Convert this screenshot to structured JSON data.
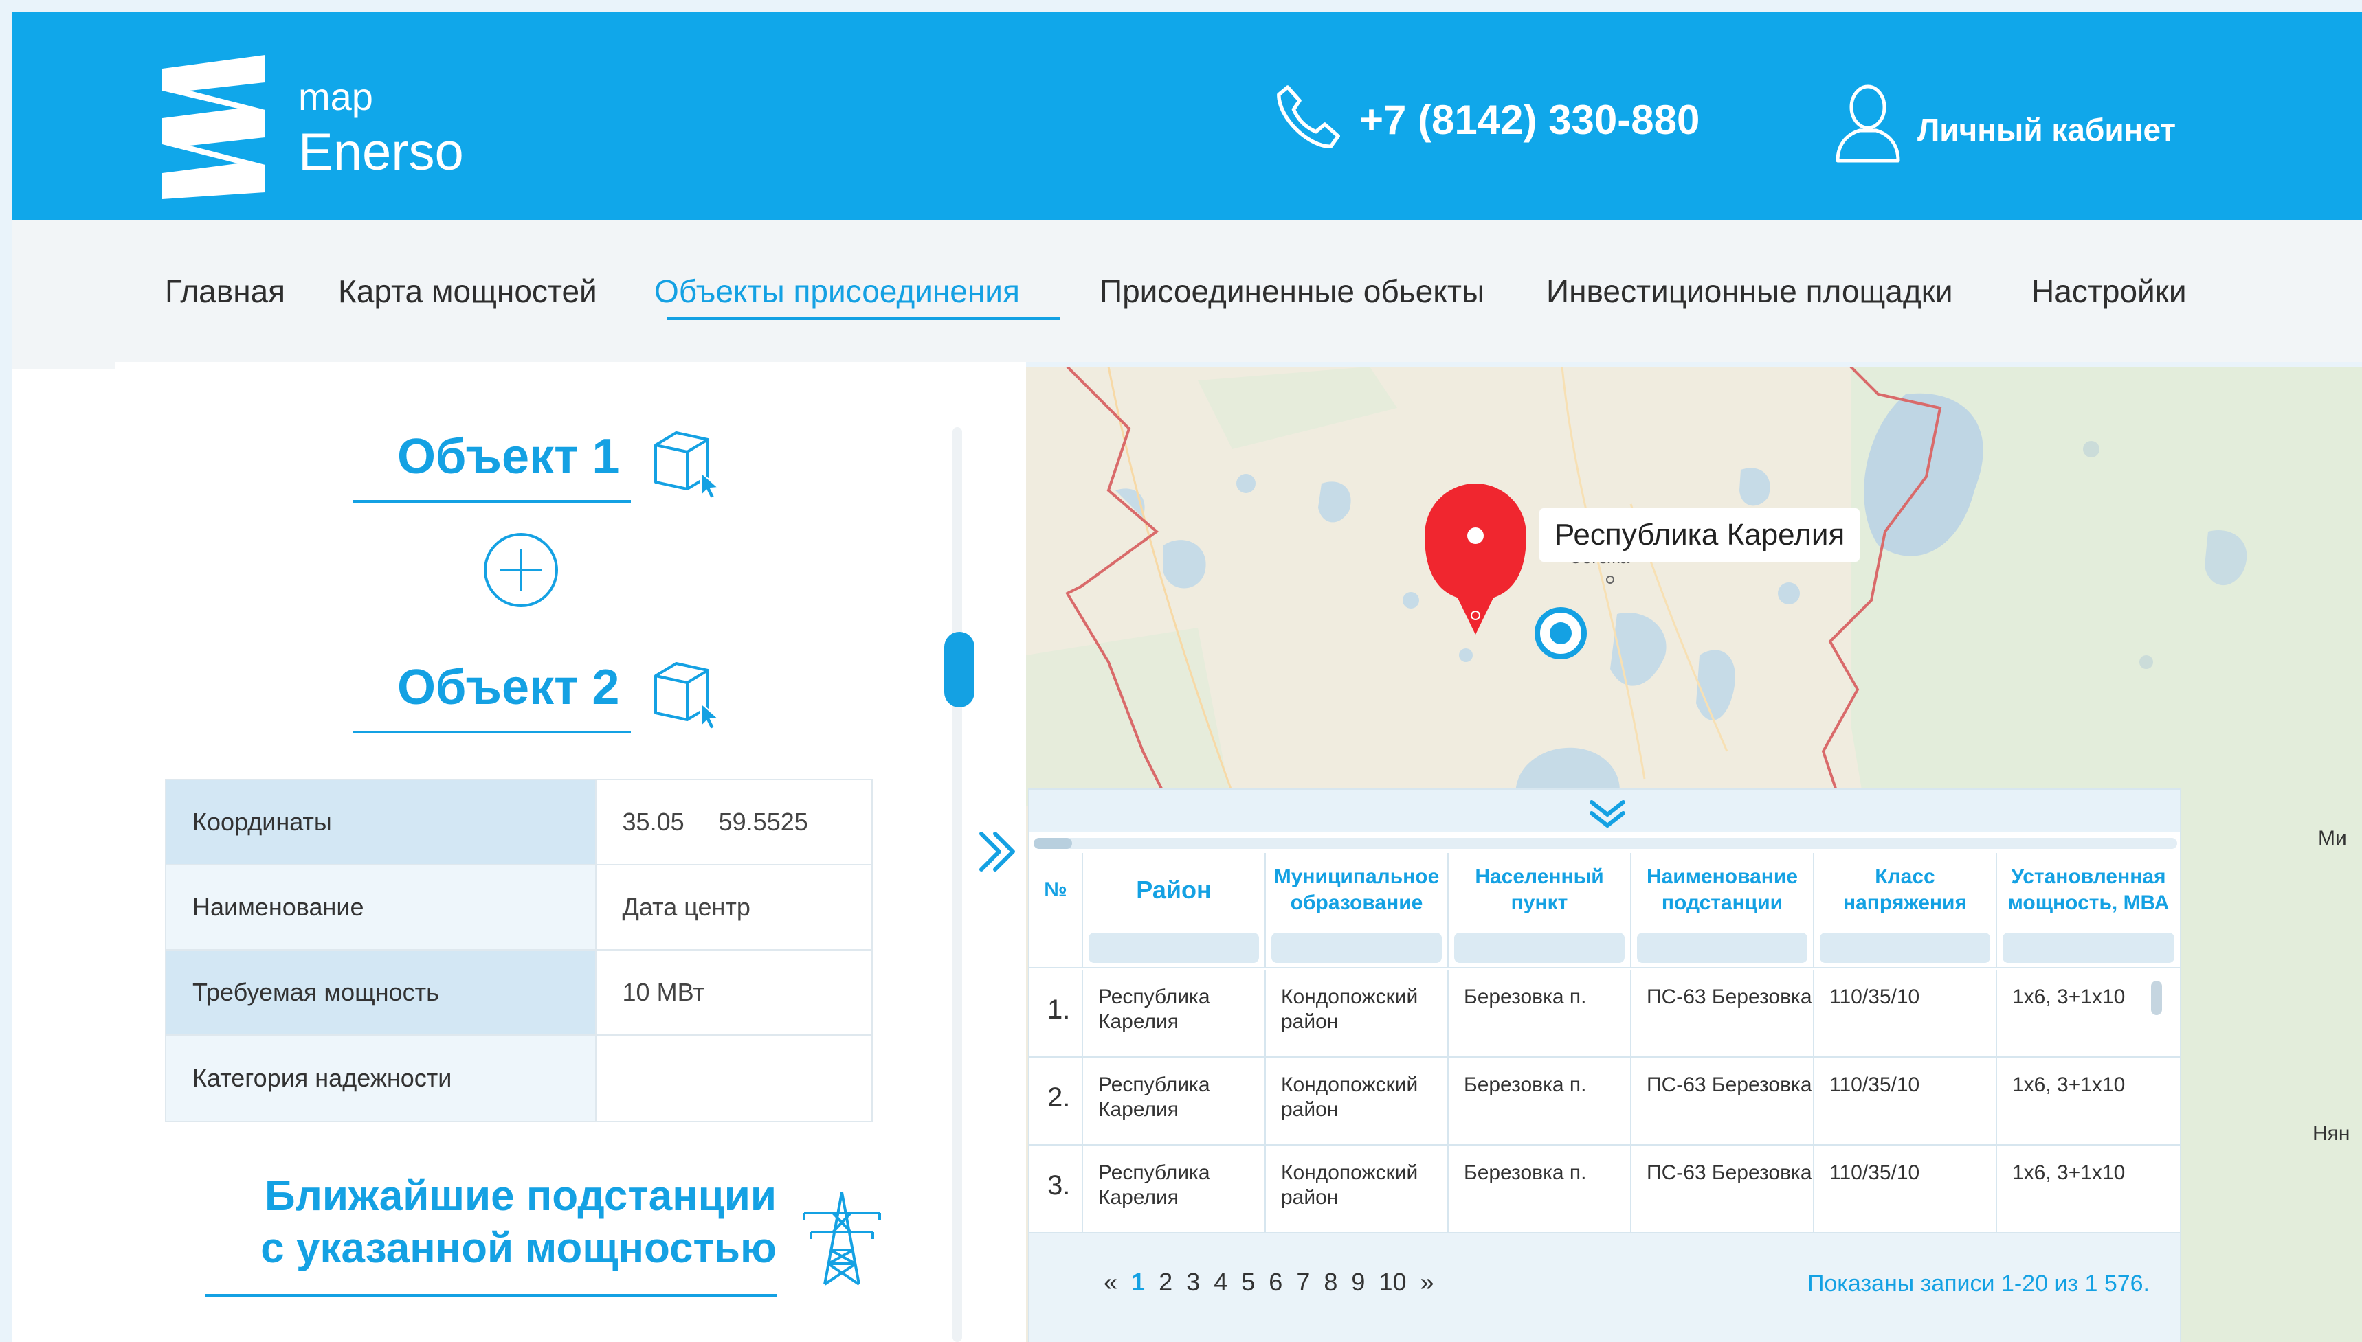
{
  "header": {
    "logo_small": "map",
    "logo_big": "Enerso",
    "phone": "+7 (8142) 330-880",
    "account": "Личный кабинет"
  },
  "nav": {
    "items": [
      {
        "label": "Главная"
      },
      {
        "label": "Карта мощностей"
      },
      {
        "label": "Объекты присоединения"
      },
      {
        "label": "Присоединенные обьекты"
      },
      {
        "label": "Инвестиционные  площадки"
      },
      {
        "label": "Настройки"
      }
    ],
    "active_index": 2
  },
  "left": {
    "object1": "Объект 1",
    "object2": "Объект 2",
    "info": [
      {
        "label": "Координаты",
        "value": "35.05     59.5525"
      },
      {
        "label": "Наименование",
        "value": "Дата центр"
      },
      {
        "label": "Требуемая мощность",
        "value": "10 МВт"
      },
      {
        "label": "Категория надежности",
        "value": ""
      }
    ],
    "nearest_line1": "Ближайшие подстанции",
    "nearest_line2": "с указанной мощностью"
  },
  "map": {
    "region_label": "Республика Карелия",
    "town_label": "Сегежа",
    "edge_label_1": "Ми",
    "edge_label_2": "Нян"
  },
  "table": {
    "columns": [
      "№",
      "Район",
      "Муниципальное образование",
      "Населенный пункт",
      "Наименование подстанции",
      "Класс напряжения",
      "Установленная мощность, МВА"
    ],
    "rows": [
      {
        "num": "1.",
        "district": "Республика Карелия",
        "municipality": "Кондопожский район",
        "settlement": "Березовка п.",
        "substation": "ПС-63 Березовка",
        "voltage": "110/35/10",
        "capacity": "1х6, 3+1х10"
      },
      {
        "num": "2.",
        "district": "Республика Карелия",
        "municipality": "Кондопожский район",
        "settlement": "Березовка п.",
        "substation": "ПС-63 Березовка",
        "voltage": "110/35/10",
        "capacity": "1х6, 3+1х10"
      },
      {
        "num": "3.",
        "district": "Республика Карелия",
        "municipality": "Кондопожский район",
        "settlement": "Березовка п.",
        "substation": "ПС-63 Березовка",
        "voltage": "110/35/10",
        "capacity": "1х6, 3+1х10"
      }
    ],
    "pager": {
      "prev": "«",
      "pages": [
        "1",
        "2",
        "3",
        "4",
        "5",
        "6",
        "7",
        "8",
        "9",
        "10"
      ],
      "current": "1",
      "next": "»"
    },
    "records_text": "Показаны записи 1-20 из 1 576."
  },
  "colors": {
    "brand_blue": "#10a7ea",
    "accent_blue": "#14a1e3",
    "marker_red": "#f0262f"
  }
}
